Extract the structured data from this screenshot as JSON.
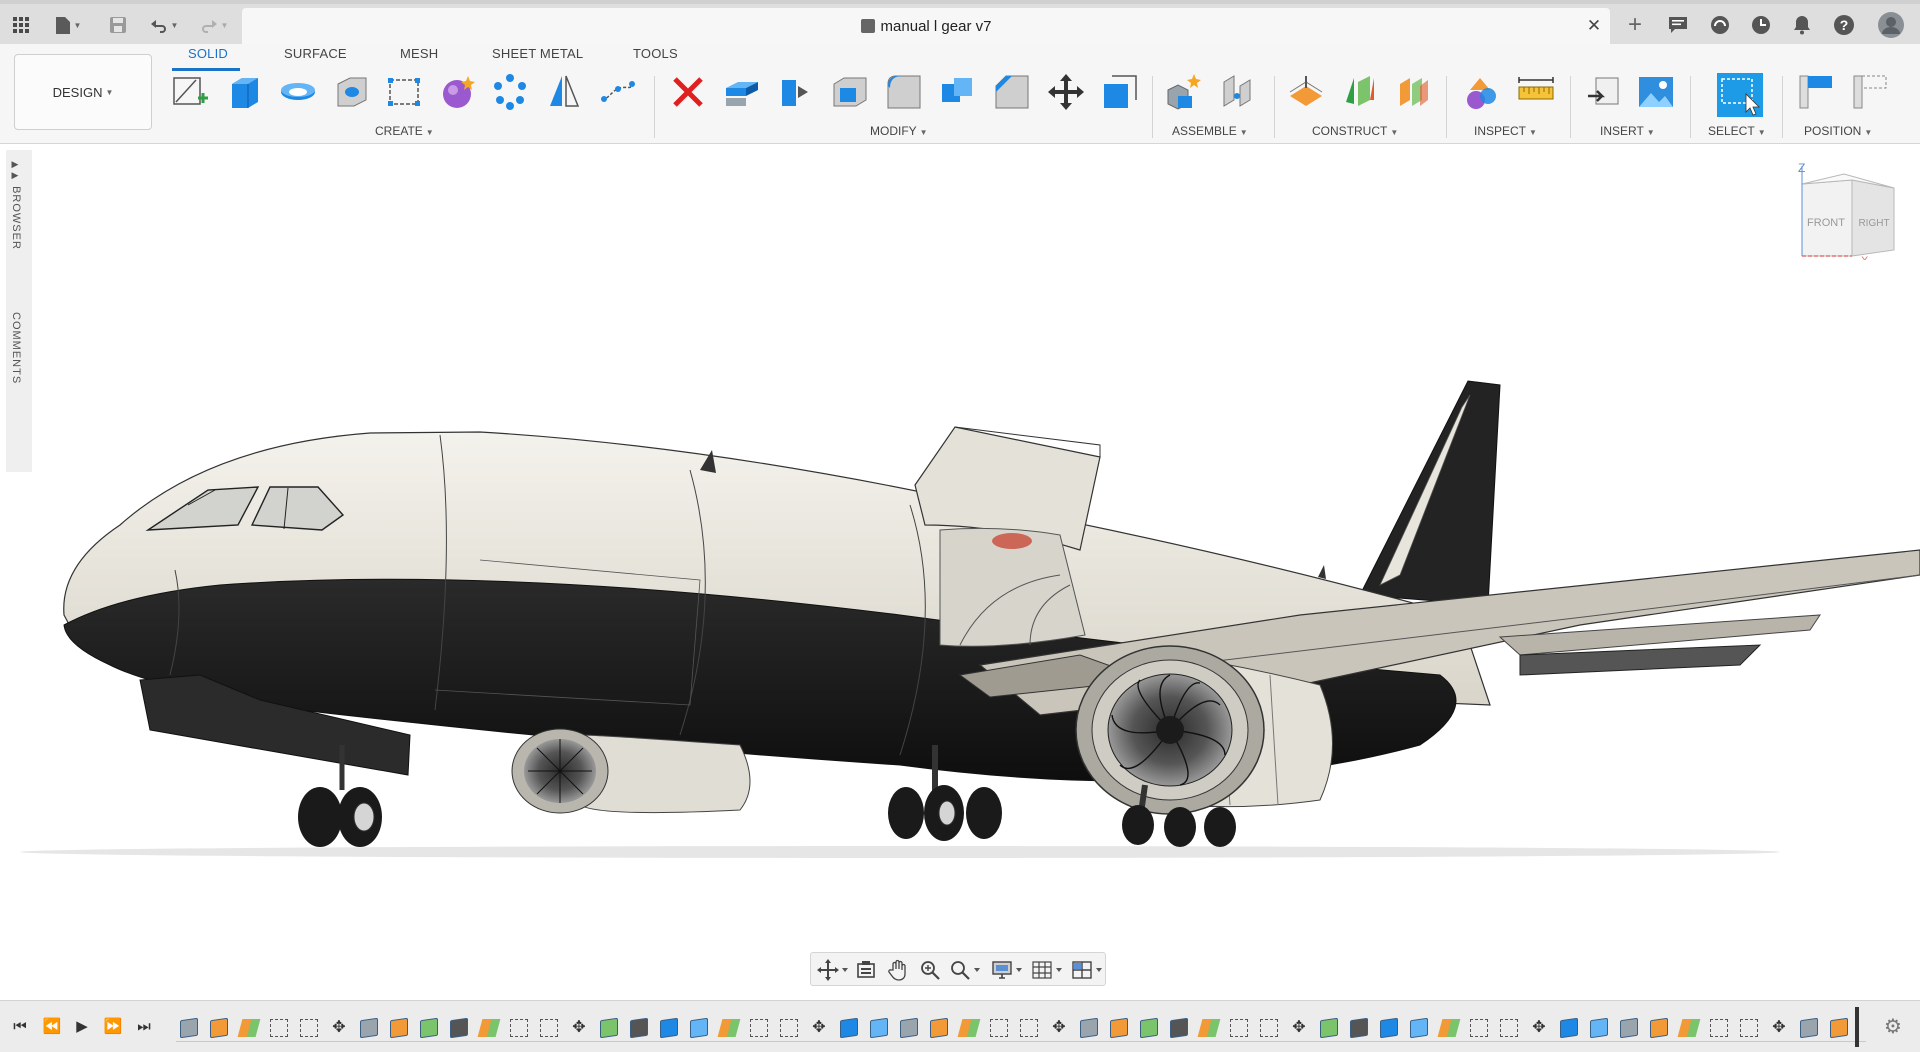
{
  "titlebar": {
    "document_title": "manual l gear v7",
    "close_glyph": "✕",
    "new_tab_glyph": "+",
    "icons": [
      "apps-grid-icon",
      "file-icon",
      "save-icon",
      "undo-icon",
      "redo-icon",
      "new-tab-icon",
      "comments-icon",
      "extensions-icon",
      "job-status-icon",
      "notifications-icon",
      "help-icon",
      "profile-icon"
    ]
  },
  "ribbon": {
    "workspace_label": "DESIGN",
    "tabs": [
      {
        "label": "SOLID",
        "active": true
      },
      {
        "label": "SURFACE",
        "active": false
      },
      {
        "label": "MESH",
        "active": false
      },
      {
        "label": "SHEET METAL",
        "active": false
      },
      {
        "label": "TOOLS",
        "active": false
      }
    ],
    "groups": [
      {
        "label": "CREATE"
      },
      {
        "label": "MODIFY"
      },
      {
        "label": "ASSEMBLE"
      },
      {
        "label": "CONSTRUCT"
      },
      {
        "label": "INSPECT"
      },
      {
        "label": "INSERT"
      },
      {
        "label": "SELECT"
      },
      {
        "label": "POSITION"
      }
    ]
  },
  "side": {
    "browser_label": "BROWSER",
    "comments_label": "COMMENTS"
  },
  "viewcube": {
    "front_label": "FRONT",
    "right_label": "RIGHT",
    "axis_z": "Z",
    "axis_x": "X"
  },
  "colors": {
    "accent": "#1a73c9",
    "fuselage_light": "#ece9e1",
    "fuselage_dark": "#1e1e1e",
    "select_blue": "#1e9be6"
  }
}
